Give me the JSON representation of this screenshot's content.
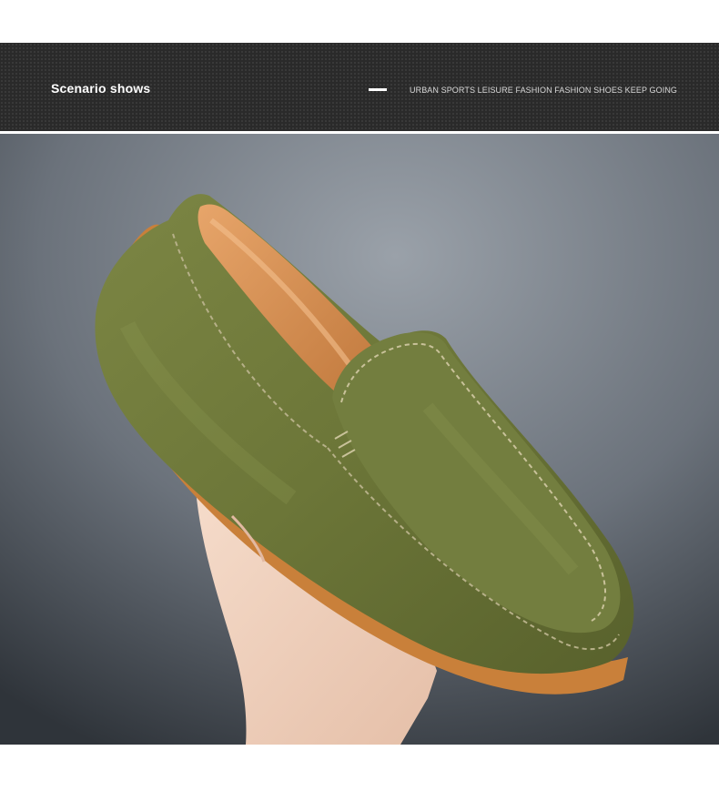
{
  "banner": {
    "title": "Scenario shows",
    "tagline": "URBAN SPORTS LEISURE FASHION FASHION SHOES KEEP GOING"
  },
  "photo": {
    "subject": "shoe-photo"
  },
  "colors": {
    "banner_bg": "#2a2a2a",
    "suede_green": "#6f7a3c",
    "sole_tan": "#c9803a",
    "backdrop_gray": "#6a717a"
  }
}
